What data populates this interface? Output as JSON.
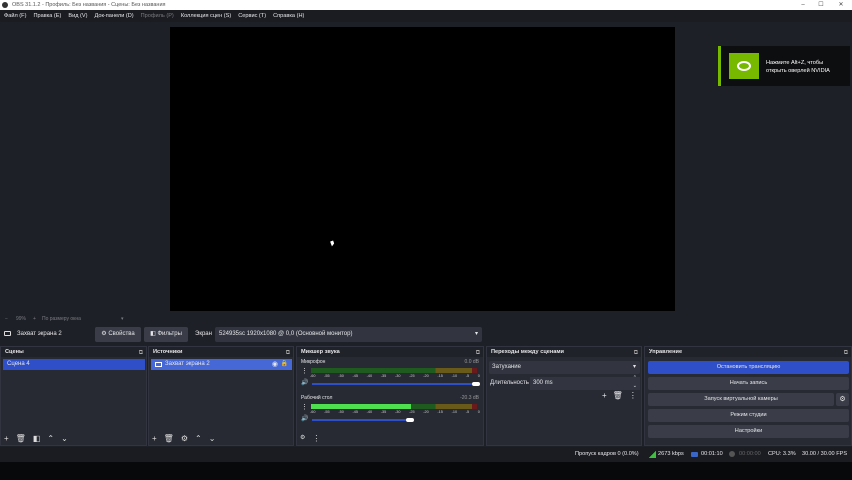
{
  "window": {
    "title": "OBS 31.1.2 - Профиль: Без названия - Сцены: Без названия",
    "min": "–",
    "max": "☐",
    "close": "✕"
  },
  "menu": [
    {
      "label": "Файл (F)"
    },
    {
      "label": "Правка (E)"
    },
    {
      "label": "Вид (V)"
    },
    {
      "label": "Док-панели (D)"
    },
    {
      "label": "Профиль (P)",
      "disabled": true
    },
    {
      "label": "Коллекция сцен (S)"
    },
    {
      "label": "Сервис (T)"
    },
    {
      "label": "Справка (H)"
    }
  ],
  "overlay": {
    "line1": "Нажмите Alt+Z, чтобы",
    "line2": "открыть оверлей NVIDIA"
  },
  "zoom": {
    "minus": "−",
    "value": "99%",
    "plus": "+",
    "mode": "По размеру окна"
  },
  "source_bar": {
    "name": "Захват экрана 2",
    "properties": "Свойства",
    "filters": "Фильтры",
    "screen_label": "Экран",
    "screen_value": "524935sc 1920x1080 @ 0,0 (Основной монитор)"
  },
  "scenes": {
    "title": "Сцены",
    "items": [
      "Сцена 4"
    ]
  },
  "sources": {
    "title": "Источники",
    "items": [
      "Захват экрана 2"
    ]
  },
  "mixer": {
    "title": "Микшер звука",
    "ticks": [
      "-60",
      "-55",
      "-50",
      "-45",
      "-40",
      "-35",
      "-30",
      "-25",
      "-20",
      "-15",
      "-10",
      "-5",
      "0"
    ],
    "channels": [
      {
        "name": "Микрофон",
        "db": "0.0 dB",
        "level": 0,
        "volume": 1.0
      },
      {
        "name": "Рабочий стол",
        "db": "-20.3 dB",
        "level": 0.6,
        "volume": 0.6
      }
    ]
  },
  "transitions": {
    "title": "Переходы между сценами",
    "selected": "Затухание",
    "duration_label": "Длительность",
    "duration": "300 ms"
  },
  "controls": {
    "title": "Управление",
    "buttons": [
      "Остановить трансляцию",
      "Начать запись",
      "Запуск виртуальной камеры",
      "Режим студии",
      "Настройки"
    ]
  },
  "status": {
    "dropped": "Пропуск кадров 0 (0.0%)",
    "bitrate": "2673 kbps",
    "stream_time": "00:01:10",
    "rec_time": "00:00:00",
    "cpu": "CPU: 3.3%",
    "fps": "30.00 / 30.00 FPS"
  },
  "colors": {
    "accent": "#2e4fc7",
    "nvidia": "#76b900"
  }
}
